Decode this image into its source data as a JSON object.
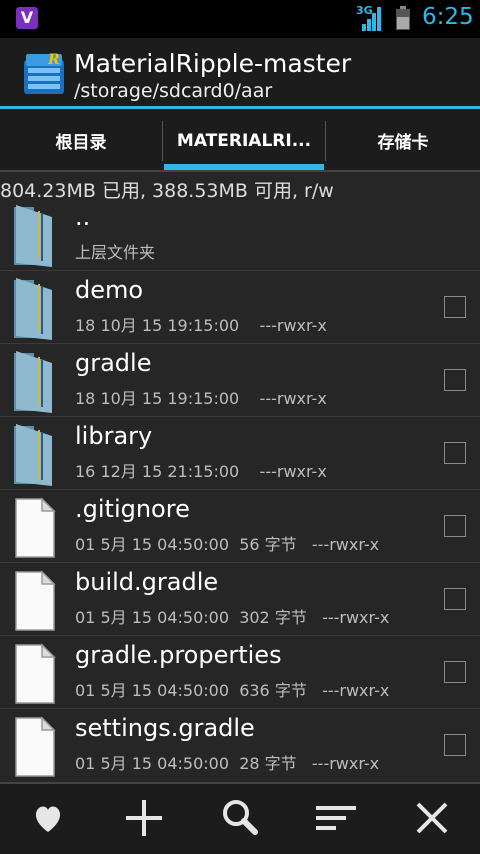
{
  "statusbar": {
    "signal_label": "3G",
    "time": "6:25"
  },
  "appbar": {
    "title": "MaterialRipple-master",
    "path": "/storage/sdcard0/aar"
  },
  "tabs": [
    {
      "label": "根目录"
    },
    {
      "label": "MATERIALRI..."
    },
    {
      "label": "存储卡"
    }
  ],
  "storage_info": "804.23MB 已用, 388.53MB 可用, r/w",
  "files": [
    {
      "name": "..",
      "meta": "上层文件夹",
      "type": "folder"
    },
    {
      "name": "demo",
      "meta": "18 10月 15 19:15:00    ---rwxr-x",
      "type": "folder"
    },
    {
      "name": "gradle",
      "meta": "18 10月 15 19:15:00    ---rwxr-x",
      "type": "folder"
    },
    {
      "name": "library",
      "meta": "16 12月 15 21:15:00    ---rwxr-x",
      "type": "folder"
    },
    {
      "name": ".gitignore",
      "meta": "01 5月 15 04:50:00  56 字节   ---rwxr-x",
      "type": "file"
    },
    {
      "name": "build.gradle",
      "meta": "01 5月 15 04:50:00  302 字节   ---rwxr-x",
      "type": "file"
    },
    {
      "name": "gradle.properties",
      "meta": "01 5月 15 04:50:00  636 字节   ---rwxr-x",
      "type": "file"
    },
    {
      "name": "settings.gradle",
      "meta": "01 5月 15 04:50:00  28 字节   ---rwxr-x",
      "type": "file"
    }
  ],
  "bottombar": {
    "icons": [
      "heart-icon",
      "plus-icon",
      "search-icon",
      "sort-icon",
      "close-icon"
    ]
  },
  "colors": {
    "accent": "#33b5e5",
    "background": "#262626",
    "bar": "#1c1c1c"
  }
}
